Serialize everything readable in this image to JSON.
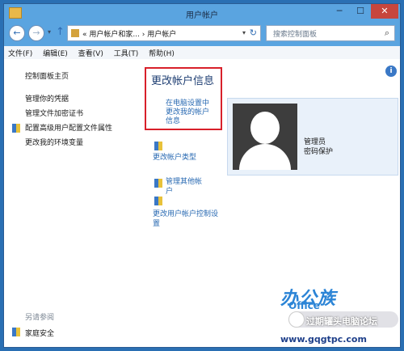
{
  "window": {
    "title": "用户帐户",
    "min_label": "─",
    "max_label": "☐",
    "close_label": "✕"
  },
  "address_bar": {
    "back_icon": "←",
    "forward_icon": "→",
    "up_icon": "↑",
    "breadcrumbs": "« 用户帐户和家... › 用户帐户",
    "refresh_icon": "↻",
    "search_placeholder": "搜索控制面板",
    "search_icon": "⌕"
  },
  "menu": [
    "文件(F)",
    "编辑(E)",
    "查看(V)",
    "工具(T)",
    "帮助(H)"
  ],
  "sidebar": {
    "home": "控制面板主页",
    "links": [
      "管理你的凭据",
      "管理文件加密证书",
      "配置高级用户配置文件属性",
      "更改我的环境变量"
    ],
    "see_also": "另请参阅",
    "family_safety": "家庭安全"
  },
  "main": {
    "heading": "更改帐户信息",
    "pc_settings_link": "在电脑设置中更改我的帐户信息",
    "change_type": "更改帐户类型",
    "manage_other": "管理其他帐户",
    "uac_settings": "更改用户帐户控制设置",
    "user": {
      "name": "管理员",
      "status": "密码保护"
    },
    "info_icon": "i"
  },
  "watermark": {
    "logo": "办公族",
    "sub": "Office",
    "banner": "过期罐头电脑论坛",
    "url": "www.gqgtpc.com"
  }
}
